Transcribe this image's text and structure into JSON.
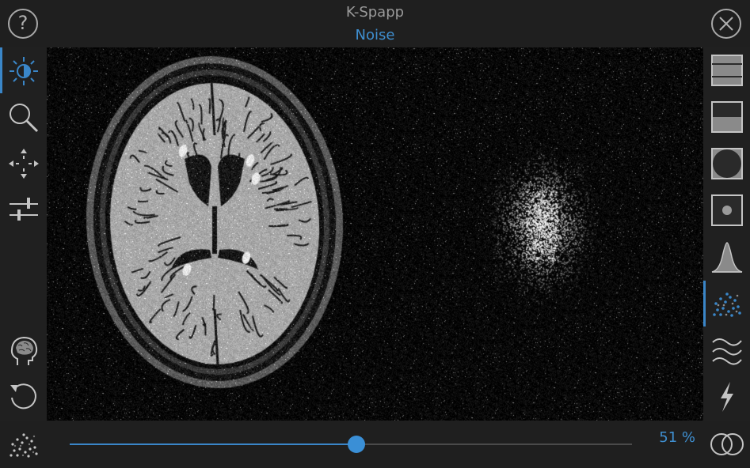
{
  "header": {
    "app_title": "K-Spapp",
    "mode_title": "Noise",
    "help_label": "?"
  },
  "left_toolbar": [
    "contrast-icon",
    "magnify-icon",
    "pan-icon",
    "sliders-icon",
    "head-icon",
    "reset-icon"
  ],
  "right_toolbar": [
    "full-kspace-icon",
    "half-kspace-icon",
    "circle-mask-icon",
    "center-dot-icon",
    "filter-curve-icon",
    "noise-icon",
    "wave-icon",
    "spike-icon"
  ],
  "selected": {
    "left": "contrast-icon",
    "right": "noise-icon"
  },
  "footer": {
    "noise_level": 0.51,
    "percent_text": "51 %"
  },
  "colors": {
    "accent": "#3a86c8",
    "background": "#1e1e1e",
    "viewer": "#050505"
  }
}
